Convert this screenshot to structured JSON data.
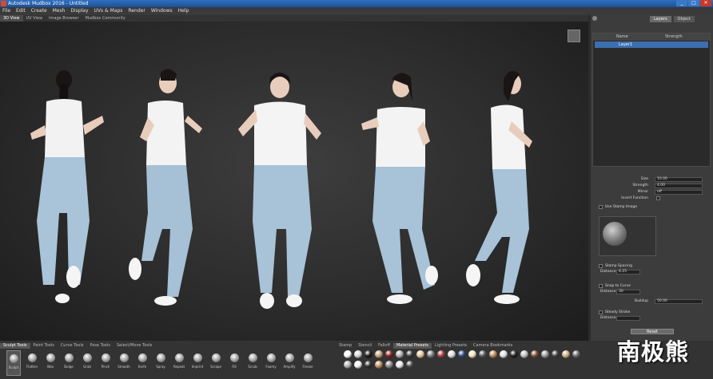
{
  "window": {
    "title": "Autodesk Mudbox 2016 - Untitled",
    "controls": [
      "_",
      "□",
      "✕"
    ]
  },
  "menu": [
    "File",
    "Edit",
    "Create",
    "Mesh",
    "Display",
    "UVs & Maps",
    "Render",
    "Windows",
    "Help"
  ],
  "view_tabs": [
    {
      "label": "3D View",
      "active": true
    },
    {
      "label": "UV View",
      "active": false
    },
    {
      "label": "Image Browser",
      "active": false
    },
    {
      "label": "Mudbox Community",
      "active": false
    }
  ],
  "right_panel": {
    "tabs": [
      {
        "label": "Layers",
        "active": true
      },
      {
        "label": "Object",
        "active": false
      }
    ],
    "layer_headers": [
      "Name",
      "Strength"
    ],
    "layer_name": "Layer1",
    "properties": {
      "size_label": "Size",
      "size_value": "10.00",
      "strength_label": "Strength",
      "strength_value": "4.00",
      "mirror_label": "Mirror",
      "mirror_value": "off",
      "invert_label": "Invert Function",
      "stamp_image_label": "Use Stamp Image",
      "stamp_spacing_label": "Stamp Spacing",
      "distance_label": "Distance",
      "distance_value": "6.25",
      "steady_label": "Snap to Curve",
      "steady_distance_label": "Distance",
      "steady_distance_value": "30",
      "buildup_label": "Buildup",
      "buildup_value": "50.00",
      "steady_stroke_label": "Steady Stroke",
      "steady_stroke_distance_label": "Distance",
      "reset_label": "Reset"
    }
  },
  "bottom": {
    "tool_tabs": [
      {
        "label": "Sculpt Tools",
        "active": true
      },
      {
        "label": "Paint Tools",
        "active": false
      },
      {
        "label": "Curve Tools",
        "active": false
      },
      {
        "label": "Pose Tools",
        "active": false
      },
      {
        "label": "Select/Move Tools",
        "active": false
      }
    ],
    "material_tabs": [
      {
        "label": "Stamp",
        "active": false
      },
      {
        "label": "Stencil",
        "active": false
      },
      {
        "label": "Falloff",
        "active": false
      },
      {
        "label": "Material Presets",
        "active": true
      },
      {
        "label": "Lighting Presets",
        "active": false
      },
      {
        "label": "Camera Bookmarks",
        "active": false
      }
    ],
    "tools": [
      "Sculpt",
      "Flatten",
      "Wax",
      "Bulge",
      "Grab",
      "Pinch",
      "Smooth",
      "Knife",
      "Spray",
      "Repeat",
      "Imprint",
      "Scrape",
      "Fill",
      "Scrub",
      "Foamy",
      "Amplify",
      "Freeze"
    ],
    "materials": [
      "#ffffff",
      "#d8d8d8",
      "#1a1a1a",
      "#c9a27a",
      "#8a2222",
      "#b0b0b0",
      "#3a3a3a",
      "#e6c49a",
      "#7a7a7a",
      "#a04040",
      "#dcdcdc",
      "#2a4a7a",
      "#f0e0c0",
      "#555555",
      "#b88a5a",
      "#e0e0e0",
      "#1f1f1f",
      "#c0c0c0",
      "#7a5030",
      "#9a9a9a",
      "#404040",
      "#d0b080",
      "#6a6a6a",
      "#b0b0b0",
      "#f4f4f4",
      "#303030",
      "#c09060",
      "#888888",
      "#e8e8e8",
      "#4a4a4a"
    ]
  },
  "watermark": "南极熊"
}
